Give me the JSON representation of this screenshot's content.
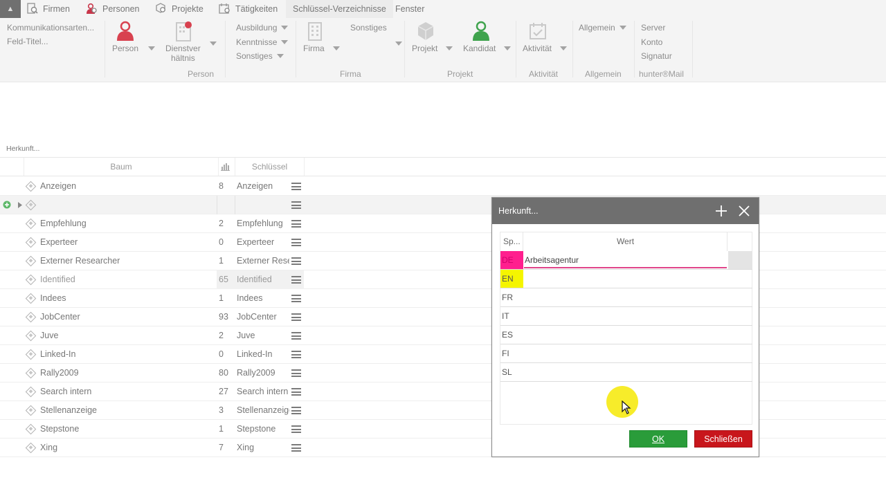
{
  "topbar": {
    "tabs": [
      {
        "label": "Firmen",
        "icon": "company-search-icon"
      },
      {
        "label": "Personen",
        "icon": "person-search-icon"
      },
      {
        "label": "Projekte",
        "icon": "project-search-icon"
      },
      {
        "label": "Tätigkeiten",
        "icon": "activity-search-icon"
      },
      {
        "label": "Schlüssel-Verzeichnisse",
        "active": true
      },
      {
        "label": "Fenster"
      }
    ]
  },
  "ribbon": {
    "left_links": [
      "Kommunikationsarten...",
      "Feld-Titel..."
    ],
    "person": {
      "person_label": "Person",
      "dienst_label_1": "Dienstver",
      "dienst_label_2": "hältnis",
      "group": "Person"
    },
    "person_more": [
      "Ausbildung",
      "Kenntnisse",
      "Sonstiges"
    ],
    "firma": {
      "sonstiges": "Sonstiges",
      "firma_label": "Firma",
      "group": "Firma"
    },
    "projekt": {
      "projekt_label": "Projekt",
      "kandidat_label": "Kandidat",
      "group": "Projekt"
    },
    "aktivitaet": {
      "label": "Aktivität",
      "group": "Aktivität"
    },
    "allgemein": {
      "label": "Allgemein",
      "group": "Allgemein"
    },
    "hunter": {
      "items": [
        "Server",
        "Konto",
        "Signatur"
      ],
      "group": "hunter®Mail"
    }
  },
  "list": {
    "title": "Herkunft...",
    "col_tree": "Baum",
    "col_key": "Schlüssel",
    "rows": [
      {
        "name": "Anzeigen",
        "count": "8",
        "key": "Anzeigen"
      },
      {
        "name": "",
        "count": "",
        "key": ""
      },
      {
        "name": "Empfehlung",
        "count": "2",
        "key": "Empfehlung"
      },
      {
        "name": "Experteer",
        "count": "0",
        "key": "Experteer"
      },
      {
        "name": "Externer Researcher",
        "count": "1",
        "key": "Externer Rese"
      },
      {
        "name": "Identified",
        "count": "65",
        "key": "Identified"
      },
      {
        "name": "Indees",
        "count": "1",
        "key": "Indees"
      },
      {
        "name": "JobCenter",
        "count": "93",
        "key": "JobCenter"
      },
      {
        "name": "Juve",
        "count": "2",
        "key": "Juve"
      },
      {
        "name": "Linked-In",
        "count": "0",
        "key": "Linked-In"
      },
      {
        "name": "Rally2009",
        "count": "80",
        "key": "Rally2009"
      },
      {
        "name": "Search intern",
        "count": "27",
        "key": "Search intern"
      },
      {
        "name": "Stellenanzeige",
        "count": "3",
        "key": "Stellenanzeige"
      },
      {
        "name": "Stepstone",
        "count": "1",
        "key": "Stepstone"
      },
      {
        "name": "Xing",
        "count": "7",
        "key": "Xing"
      }
    ]
  },
  "dialog": {
    "title": "Herkunft...",
    "col_lang": "Sp...",
    "col_value": "Wert",
    "rows": [
      {
        "lang": "DE",
        "value": "Arbeitsagentur"
      },
      {
        "lang": "EN",
        "value": ""
      },
      {
        "lang": "FR",
        "value": ""
      },
      {
        "lang": "IT",
        "value": ""
      },
      {
        "lang": "ES",
        "value": ""
      },
      {
        "lang": "FI",
        "value": ""
      },
      {
        "lang": "SL",
        "value": ""
      }
    ],
    "ok_label": "OK",
    "close_label": "Schließen"
  },
  "colors": {
    "de_highlight": "#ff1f8e",
    "en_highlight": "#f5f500",
    "ok_button": "#2a9c3a",
    "close_button": "#c8161c"
  }
}
